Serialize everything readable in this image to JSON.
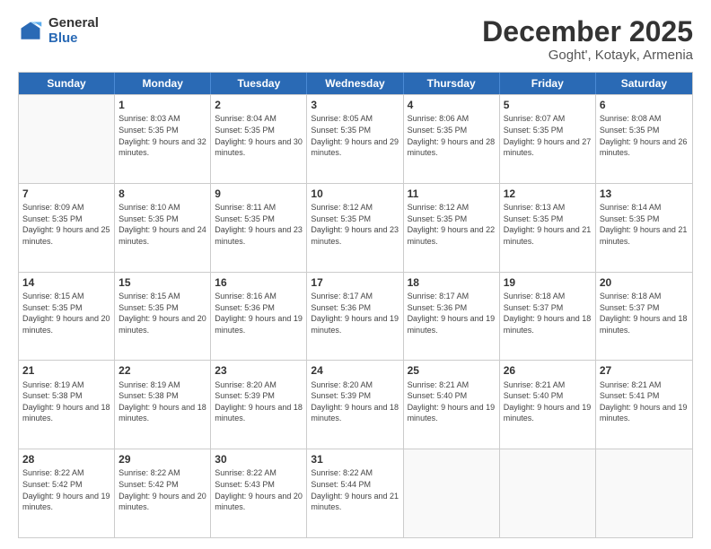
{
  "logo": {
    "general": "General",
    "blue": "Blue"
  },
  "title": "December 2025",
  "subtitle": "Goght', Kotayk, Armenia",
  "header_days": [
    "Sunday",
    "Monday",
    "Tuesday",
    "Wednesday",
    "Thursday",
    "Friday",
    "Saturday"
  ],
  "weeks": [
    [
      {
        "day": "",
        "sunrise": "",
        "sunset": "",
        "daylight": ""
      },
      {
        "day": "1",
        "sunrise": "Sunrise: 8:03 AM",
        "sunset": "Sunset: 5:35 PM",
        "daylight": "Daylight: 9 hours and 32 minutes."
      },
      {
        "day": "2",
        "sunrise": "Sunrise: 8:04 AM",
        "sunset": "Sunset: 5:35 PM",
        "daylight": "Daylight: 9 hours and 30 minutes."
      },
      {
        "day": "3",
        "sunrise": "Sunrise: 8:05 AM",
        "sunset": "Sunset: 5:35 PM",
        "daylight": "Daylight: 9 hours and 29 minutes."
      },
      {
        "day": "4",
        "sunrise": "Sunrise: 8:06 AM",
        "sunset": "Sunset: 5:35 PM",
        "daylight": "Daylight: 9 hours and 28 minutes."
      },
      {
        "day": "5",
        "sunrise": "Sunrise: 8:07 AM",
        "sunset": "Sunset: 5:35 PM",
        "daylight": "Daylight: 9 hours and 27 minutes."
      },
      {
        "day": "6",
        "sunrise": "Sunrise: 8:08 AM",
        "sunset": "Sunset: 5:35 PM",
        "daylight": "Daylight: 9 hours and 26 minutes."
      }
    ],
    [
      {
        "day": "7",
        "sunrise": "Sunrise: 8:09 AM",
        "sunset": "Sunset: 5:35 PM",
        "daylight": "Daylight: 9 hours and 25 minutes."
      },
      {
        "day": "8",
        "sunrise": "Sunrise: 8:10 AM",
        "sunset": "Sunset: 5:35 PM",
        "daylight": "Daylight: 9 hours and 24 minutes."
      },
      {
        "day": "9",
        "sunrise": "Sunrise: 8:11 AM",
        "sunset": "Sunset: 5:35 PM",
        "daylight": "Daylight: 9 hours and 23 minutes."
      },
      {
        "day": "10",
        "sunrise": "Sunrise: 8:12 AM",
        "sunset": "Sunset: 5:35 PM",
        "daylight": "Daylight: 9 hours and 23 minutes."
      },
      {
        "day": "11",
        "sunrise": "Sunrise: 8:12 AM",
        "sunset": "Sunset: 5:35 PM",
        "daylight": "Daylight: 9 hours and 22 minutes."
      },
      {
        "day": "12",
        "sunrise": "Sunrise: 8:13 AM",
        "sunset": "Sunset: 5:35 PM",
        "daylight": "Daylight: 9 hours and 21 minutes."
      },
      {
        "day": "13",
        "sunrise": "Sunrise: 8:14 AM",
        "sunset": "Sunset: 5:35 PM",
        "daylight": "Daylight: 9 hours and 21 minutes."
      }
    ],
    [
      {
        "day": "14",
        "sunrise": "Sunrise: 8:15 AM",
        "sunset": "Sunset: 5:35 PM",
        "daylight": "Daylight: 9 hours and 20 minutes."
      },
      {
        "day": "15",
        "sunrise": "Sunrise: 8:15 AM",
        "sunset": "Sunset: 5:35 PM",
        "daylight": "Daylight: 9 hours and 20 minutes."
      },
      {
        "day": "16",
        "sunrise": "Sunrise: 8:16 AM",
        "sunset": "Sunset: 5:36 PM",
        "daylight": "Daylight: 9 hours and 19 minutes."
      },
      {
        "day": "17",
        "sunrise": "Sunrise: 8:17 AM",
        "sunset": "Sunset: 5:36 PM",
        "daylight": "Daylight: 9 hours and 19 minutes."
      },
      {
        "day": "18",
        "sunrise": "Sunrise: 8:17 AM",
        "sunset": "Sunset: 5:36 PM",
        "daylight": "Daylight: 9 hours and 19 minutes."
      },
      {
        "day": "19",
        "sunrise": "Sunrise: 8:18 AM",
        "sunset": "Sunset: 5:37 PM",
        "daylight": "Daylight: 9 hours and 18 minutes."
      },
      {
        "day": "20",
        "sunrise": "Sunrise: 8:18 AM",
        "sunset": "Sunset: 5:37 PM",
        "daylight": "Daylight: 9 hours and 18 minutes."
      }
    ],
    [
      {
        "day": "21",
        "sunrise": "Sunrise: 8:19 AM",
        "sunset": "Sunset: 5:38 PM",
        "daylight": "Daylight: 9 hours and 18 minutes."
      },
      {
        "day": "22",
        "sunrise": "Sunrise: 8:19 AM",
        "sunset": "Sunset: 5:38 PM",
        "daylight": "Daylight: 9 hours and 18 minutes."
      },
      {
        "day": "23",
        "sunrise": "Sunrise: 8:20 AM",
        "sunset": "Sunset: 5:39 PM",
        "daylight": "Daylight: 9 hours and 18 minutes."
      },
      {
        "day": "24",
        "sunrise": "Sunrise: 8:20 AM",
        "sunset": "Sunset: 5:39 PM",
        "daylight": "Daylight: 9 hours and 18 minutes."
      },
      {
        "day": "25",
        "sunrise": "Sunrise: 8:21 AM",
        "sunset": "Sunset: 5:40 PM",
        "daylight": "Daylight: 9 hours and 19 minutes."
      },
      {
        "day": "26",
        "sunrise": "Sunrise: 8:21 AM",
        "sunset": "Sunset: 5:40 PM",
        "daylight": "Daylight: 9 hours and 19 minutes."
      },
      {
        "day": "27",
        "sunrise": "Sunrise: 8:21 AM",
        "sunset": "Sunset: 5:41 PM",
        "daylight": "Daylight: 9 hours and 19 minutes."
      }
    ],
    [
      {
        "day": "28",
        "sunrise": "Sunrise: 8:22 AM",
        "sunset": "Sunset: 5:42 PM",
        "daylight": "Daylight: 9 hours and 19 minutes."
      },
      {
        "day": "29",
        "sunrise": "Sunrise: 8:22 AM",
        "sunset": "Sunset: 5:42 PM",
        "daylight": "Daylight: 9 hours and 20 minutes."
      },
      {
        "day": "30",
        "sunrise": "Sunrise: 8:22 AM",
        "sunset": "Sunset: 5:43 PM",
        "daylight": "Daylight: 9 hours and 20 minutes."
      },
      {
        "day": "31",
        "sunrise": "Sunrise: 8:22 AM",
        "sunset": "Sunset: 5:44 PM",
        "daylight": "Daylight: 9 hours and 21 minutes."
      },
      {
        "day": "",
        "sunrise": "",
        "sunset": "",
        "daylight": ""
      },
      {
        "day": "",
        "sunrise": "",
        "sunset": "",
        "daylight": ""
      },
      {
        "day": "",
        "sunrise": "",
        "sunset": "",
        "daylight": ""
      }
    ]
  ]
}
